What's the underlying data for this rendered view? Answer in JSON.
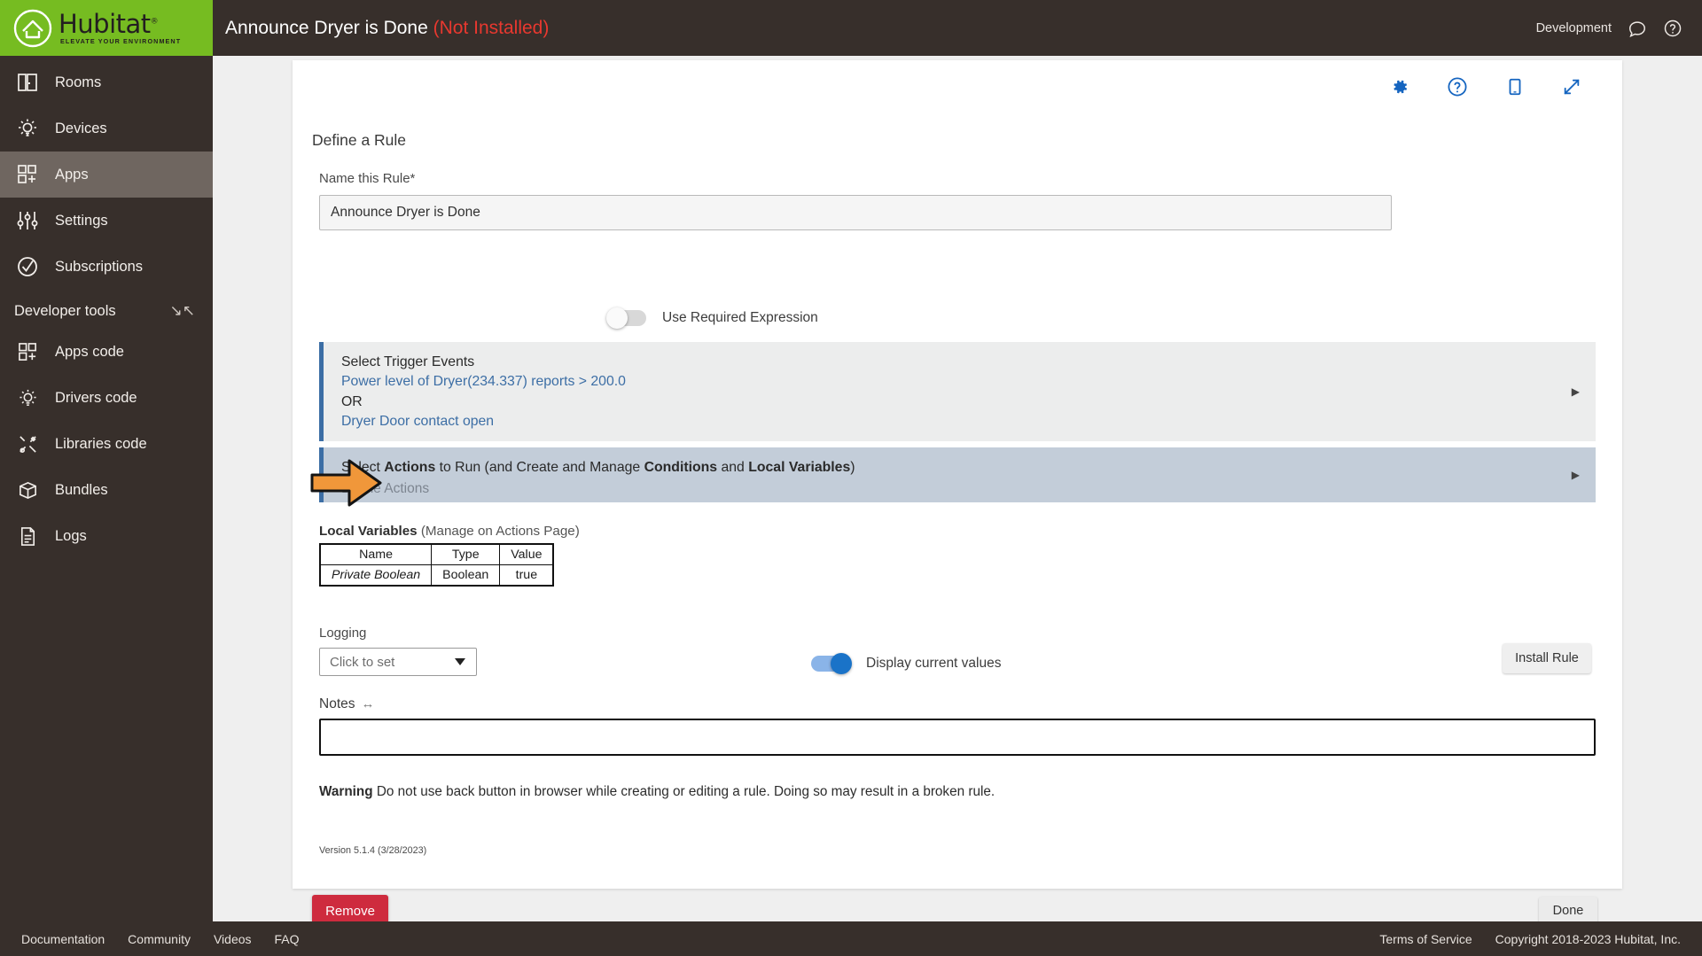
{
  "brand": {
    "name": "Hubitat",
    "tagline": "ELEVATE YOUR ENVIRONMENT",
    "registered": "®"
  },
  "sidebar": {
    "items": [
      {
        "label": "Rooms",
        "icon": "rooms-icon",
        "active": false
      },
      {
        "label": "Devices",
        "icon": "devices-icon",
        "active": false
      },
      {
        "label": "Apps",
        "icon": "apps-icon",
        "active": true
      },
      {
        "label": "Settings",
        "icon": "settings-icon",
        "active": false
      },
      {
        "label": "Subscriptions",
        "icon": "subscriptions-icon",
        "active": false
      }
    ],
    "developer_tools": {
      "label": "Developer tools",
      "collapse_icon": "collapse-icon",
      "items": [
        {
          "label": "Apps code",
          "icon": "apps-code-icon"
        },
        {
          "label": "Drivers code",
          "icon": "drivers-code-icon"
        },
        {
          "label": "Libraries code",
          "icon": "libraries-code-icon"
        },
        {
          "label": "Bundles",
          "icon": "bundles-icon"
        },
        {
          "label": "Logs",
          "icon": "logs-icon"
        }
      ]
    }
  },
  "topbar": {
    "app_title": "Announce Dryer is Done",
    "status": "(Not Installed)",
    "status_color": "#e8382f",
    "environment": "Development",
    "icons": [
      {
        "name": "chat-icon"
      },
      {
        "name": "help-circle-icon"
      }
    ]
  },
  "card": {
    "icons": [
      {
        "name": "gear-icon",
        "color": "#1565c0"
      },
      {
        "name": "help-circle-icon",
        "color": "#1565c0"
      },
      {
        "name": "mobile-icon",
        "color": "#1565c0"
      },
      {
        "name": "expand-icon",
        "color": "#1565c0"
      }
    ],
    "section_title": "Define a Rule",
    "name_field": {
      "label": "Name this Rule*",
      "value": "Announce Dryer is Done",
      "placeholder": "Name this Rule"
    },
    "required_expression": {
      "label": "Use Required Expression",
      "state": "off"
    },
    "trigger_events": {
      "heading": "Select Trigger Events",
      "line1": "Power level of Dryer(234.337) reports > 200.0",
      "line2": "OR",
      "line3": "Dryer Door contact open",
      "caret": "caret-right-icon"
    },
    "actions": {
      "heading_pre": "Select ",
      "heading_bold1": "Actions",
      "heading_mid": " to Run (and Create and Manage ",
      "heading_bold2": "Conditions",
      "heading_and": " and ",
      "heading_bold3": "Local Variables",
      "heading_close": ")",
      "subtext": "Define Actions",
      "caret": "caret-right-icon",
      "annotation_arrow_color": "#f39c2d"
    },
    "local_variables": {
      "title_bold": "Local Variables",
      "title_rest": " (Manage on Actions Page)",
      "columns": [
        "Name",
        "Type",
        "Value"
      ],
      "rows": [
        [
          "Private Boolean",
          "Boolean",
          "true"
        ]
      ]
    },
    "logging": {
      "label": "Logging",
      "select_value": "Click to set",
      "display_values_label": "Display current values",
      "display_values_state": "on"
    },
    "install_button": "Install Rule",
    "notes": {
      "label": "Notes",
      "resize_icon": "↔",
      "value": "",
      "placeholder": ""
    },
    "warning": {
      "bold": "Warning",
      "text": " Do not use back button in browser while creating or editing a rule. Doing so may result in a broken rule."
    },
    "version": "Version 5.1.4 (3/28/2023)",
    "remove_button": "Remove",
    "done_button": "Done"
  },
  "footer": {
    "left": [
      "Documentation",
      "Community",
      "Videos",
      "FAQ"
    ],
    "right": [
      "Terms of Service",
      "Copyright 2018-2023 Hubitat, Inc."
    ]
  }
}
